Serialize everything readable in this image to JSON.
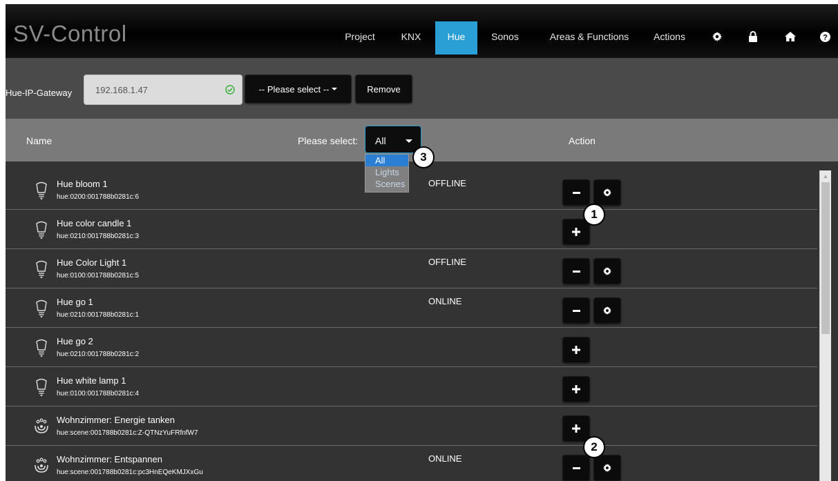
{
  "app": {
    "title": "SV-Control"
  },
  "nav": {
    "items": [
      {
        "label": "Project"
      },
      {
        "label": "KNX"
      },
      {
        "label": "Hue",
        "active": true
      },
      {
        "label": "Sonos"
      },
      {
        "label": "Areas & Functions"
      },
      {
        "label": "Actions"
      }
    ],
    "icons": [
      "gear-icon",
      "lock-icon",
      "home-icon",
      "help-icon"
    ]
  },
  "gateway": {
    "label": "Hue-IP-Gateway",
    "ip": "192.168.1.47",
    "select_label": "-- Please select --",
    "remove_label": "Remove"
  },
  "table": {
    "col_name": "Name",
    "filter_label": "Please select:",
    "filter_value": "All",
    "filter_options": [
      "All",
      "Lights",
      "Scenes"
    ],
    "col_action": "Action"
  },
  "rows": [
    {
      "name": "Hue bloom 1",
      "id": "hue:0200:001788b0281c:6",
      "status": "OFFLINE",
      "type": "light",
      "actions": [
        "remove",
        "settings"
      ]
    },
    {
      "name": "Hue color candle 1",
      "id": "hue:0210:001788b0281c:3",
      "status": "",
      "type": "light",
      "actions": [
        "add"
      ]
    },
    {
      "name": "Hue Color Light 1",
      "id": "hue:0100:001788b0281c:5",
      "status": "OFFLINE",
      "type": "light",
      "actions": [
        "remove",
        "settings"
      ]
    },
    {
      "name": "Hue go 1",
      "id": "hue:0210:001788b0281c:1",
      "status": "ONLINE",
      "type": "light",
      "actions": [
        "remove",
        "settings"
      ]
    },
    {
      "name": "Hue go 2",
      "id": "hue:0210:001788b0281c:2",
      "status": "",
      "type": "light",
      "actions": [
        "add"
      ]
    },
    {
      "name": "Hue white lamp 1",
      "id": "hue:0100:001788b0281c:4",
      "status": "",
      "type": "light",
      "actions": [
        "add"
      ]
    },
    {
      "name": "Wohnzimmer: Energie tanken",
      "id": "hue:scene:001788b0281c:Z-QTNzYuFRfnfW7",
      "status": "",
      "type": "scene",
      "actions": [
        "add"
      ]
    },
    {
      "name": "Wohnzimmer: Entspannen",
      "id": "hue:scene:001788b0281c:pc3HnEQeKMJXxGu",
      "status": "ONLINE",
      "type": "scene",
      "actions": [
        "remove",
        "settings"
      ]
    }
  ],
  "callouts": [
    "1",
    "2",
    "3"
  ],
  "colors": {
    "accent": "#2a9fd6",
    "background": "#333333",
    "header": "#7a7a7a"
  }
}
